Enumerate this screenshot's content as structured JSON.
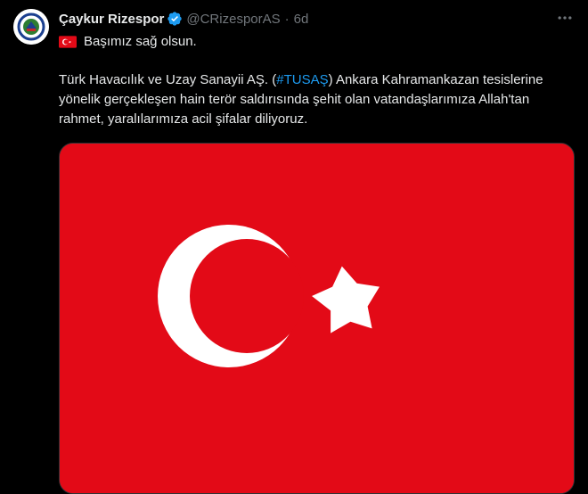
{
  "tweet": {
    "author_name": "Çaykur Rizespor",
    "handle": "@CRizesporAS",
    "separator": "·",
    "time": "6d",
    "line1": "Başımız sağ olsun.",
    "body_before_hashtag": "Türk Havacılık ve Uzay Sanayii AŞ. (",
    "hashtag": "#TUSAŞ",
    "body_after_hashtag": ") Ankara Kahramankazan tesislerine yönelik gerçekleşen hain terör saldırısında şehit olan vatandaşlarımıza Allah'tan rahmet, yaralılarımıza acil şifalar diliyoruz."
  },
  "icons": {
    "verified": "verified-badge-icon",
    "more": "more-icon",
    "flag": "turkey-flag-icon"
  },
  "colors": {
    "background": "#000000",
    "text": "#e7e9ea",
    "muted": "#71767b",
    "link": "#1d9bf0",
    "flag_red": "#e30a17",
    "verified_blue": "#1d9bf0"
  }
}
